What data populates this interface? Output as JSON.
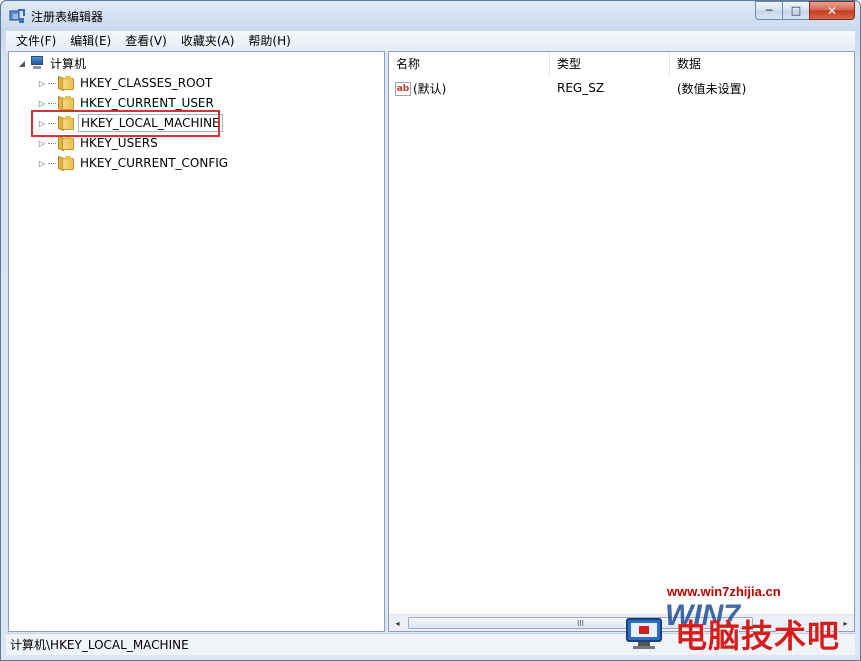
{
  "window": {
    "title": "注册表编辑器",
    "minimize_glyph": "─",
    "maximize_glyph": "□",
    "close_glyph": "✕"
  },
  "menu": [
    "文件(F)",
    "编辑(E)",
    "查看(V)",
    "收藏夹(A)",
    "帮助(H)"
  ],
  "tree": {
    "root": {
      "label": "计算机",
      "expander": "◢"
    },
    "children": [
      {
        "label": "HKEY_CLASSES_ROOT",
        "expander": "▷"
      },
      {
        "label": "HKEY_CURRENT_USER",
        "expander": "▷"
      },
      {
        "label": "HKEY_LOCAL_MACHINE",
        "expander": "▷",
        "selected": true
      },
      {
        "label": "HKEY_USERS",
        "expander": "▷"
      },
      {
        "label": "HKEY_CURRENT_CONFIG",
        "expander": "▷"
      }
    ]
  },
  "list": {
    "columns": [
      "名称",
      "类型",
      "数据"
    ],
    "rows": [
      {
        "icon": "ab",
        "name": "(默认)",
        "type": "REG_SZ",
        "data": "(数值未设置)"
      }
    ]
  },
  "scrollbar": {
    "left_arrow": "◂",
    "right_arrow": "▸",
    "thumb_grip": "III"
  },
  "status": {
    "path": "计算机\\HKEY_LOCAL_MACHINE"
  },
  "watermark": {
    "url": "www.win7zhijia.cn",
    "logo_text": "WIN7",
    "brand": "电脑技术吧"
  },
  "colors": {
    "highlight_border": "#d73331",
    "watermark_red": "#d81b1b",
    "folder_yellow": "#e9bf4d"
  }
}
